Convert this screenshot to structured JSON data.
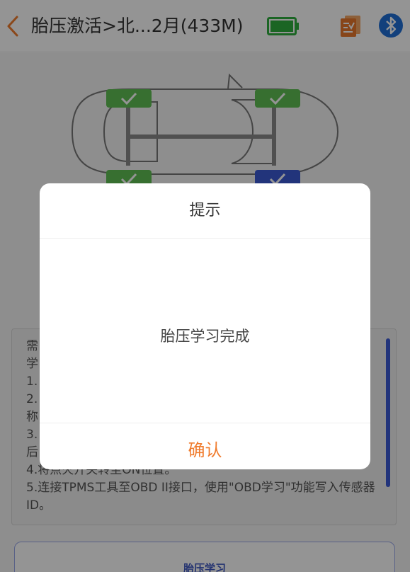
{
  "header": {
    "title": "胎压激活>北...2月(433M)",
    "back_icon": "chevron-left-icon",
    "battery_icon": "battery-icon",
    "report_icon": "report-icon",
    "bluetooth_icon": "bluetooth-icon"
  },
  "colors": {
    "accent_orange": "#f07c2e",
    "battery_green": "#2fae3e",
    "bluetooth_blue": "#1f6fd6",
    "tire_green": "#5fbf53",
    "tire_blue": "#3b5bd4"
  },
  "instructions": {
    "lines": [
      "需",
      "学",
      "1.",
      "2.",
      "称",
      "3.",
      "后",
      "4.将点火开关转至ON位置。",
      "5.连接TPMS工具至OBD II接口，使用\"OBD学习\"功能写入传感器",
      "ID。"
    ]
  },
  "learn_button": {
    "label": "胎压学习"
  },
  "dialog": {
    "title": "提示",
    "message": "胎压学习完成",
    "confirm_label": "确认"
  }
}
